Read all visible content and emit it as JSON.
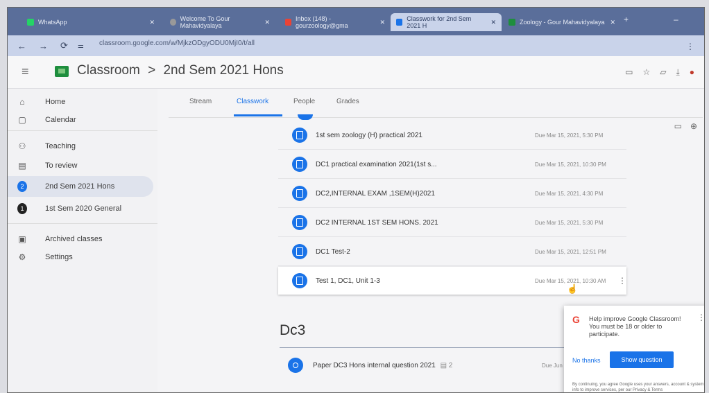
{
  "browser": {
    "tabs": [
      {
        "label": "WhatsApp",
        "color": "#25d366"
      },
      {
        "label": "Welcome To Gour Mahavidyalaya",
        "color": "#555555"
      },
      {
        "label": "Inbox (148) - gourzoology@gma",
        "color": "#ea4335"
      },
      {
        "label": "Classwork for 2nd Sem 2021 H",
        "color": "#1a73e8"
      },
      {
        "label": "Zoology - Gour Mahavidyalaya",
        "color": "#1e8e3e"
      }
    ],
    "url": "classroom.google.com/w/MjkzODgyODU0MjI0/t/all"
  },
  "header": {
    "app_name": "Classroom",
    "separator": ">",
    "class_name": "2nd Sem 2021 Hons"
  },
  "sidebar": {
    "items": [
      {
        "label": "Home",
        "icon": "home-icon"
      },
      {
        "label": "Calendar",
        "icon": "calendar-icon"
      },
      {
        "label": "Teaching",
        "icon": "people-icon"
      },
      {
        "label": "To review",
        "icon": "review-icon"
      },
      {
        "label": "2nd Sem 2021 Hons",
        "badge": "2",
        "badge_color": "#1a73e8"
      },
      {
        "label": "1st Sem 2020 General",
        "badge": "1",
        "badge_color": "#222222"
      },
      {
        "label": "Archived classes",
        "icon": "archive-icon"
      },
      {
        "label": "Settings",
        "icon": "gear-icon"
      }
    ]
  },
  "tabs": [
    "Stream",
    "Classwork",
    "People",
    "Grades"
  ],
  "assignments": [
    {
      "title": "1st sem zoology (H) practical 2021",
      "due": "Due Mar 15, 2021, 5:30 PM"
    },
    {
      "title": "DC1 practical examination 2021(1st s...",
      "due": "Due Mar 15, 2021, 10:30 PM"
    },
    {
      "title": "DC2,INTERNAL EXAM ,1SEM(H)2021",
      "due": "Due Mar 15, 2021, 4:30 PM"
    },
    {
      "title": "DC2 INTERNAL 1ST SEM HONS. 2021",
      "due": "Due Mar 15, 2021, 5:30 PM"
    },
    {
      "title": "DC1 Test-2",
      "due": "Due Mar 15, 2021, 12:51 PM"
    },
    {
      "title": "Test 1, DC1, Unit 1-3",
      "due": "Due Mar 15, 2021, 10:30 AM"
    }
  ],
  "section": {
    "title": "Dc3",
    "item": {
      "title": "Paper DC3 Hons internal question 2021",
      "attachments": "2",
      "due": "Due Jun"
    }
  },
  "popup": {
    "text": "Help improve Google Classroom! You must be 18 or older to participate.",
    "no_thanks": "No thanks",
    "show_question": "Show question",
    "footer": "By continuing, you agree Google uses your answers, account & system info to improve services, per our Privacy & Terms"
  }
}
